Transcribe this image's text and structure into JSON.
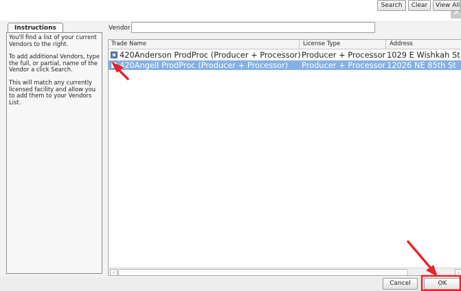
{
  "window": {
    "close_glyph": "✕"
  },
  "instructions": {
    "tab_label": "Instructions",
    "paragraphs": [
      "You'll find a list of your current Vendors to the right.",
      "To add additional Vendors, type the full, or partial, name of the Vendor a click Search.",
      "This will match any currently licensed facility and allow you to add them to your Vendors List."
    ]
  },
  "search": {
    "label": "Vendor",
    "value": "",
    "search_button": "Search",
    "clear_button": "Clear",
    "view_all_button": "View All"
  },
  "table": {
    "columns": [
      "Trade Name",
      "License Type",
      "Address"
    ],
    "rows": [
      {
        "trade_name": "420Anderson ProdProc (Producer + Processor)",
        "license_type": "Producer + Processor",
        "address": "1029 E Wishkah St",
        "checked": true,
        "selected": false
      },
      {
        "trade_name": "420Angell ProdProc (Producer + Processor)",
        "license_type": "Producer + Processor",
        "address": "12026 NE 85th St",
        "checked": false,
        "selected": true
      }
    ]
  },
  "footer": {
    "cancel_button": "Cancel",
    "ok_button": "OK"
  },
  "colors": {
    "selection": "#85b0e3",
    "annotation": "#e8232e"
  }
}
